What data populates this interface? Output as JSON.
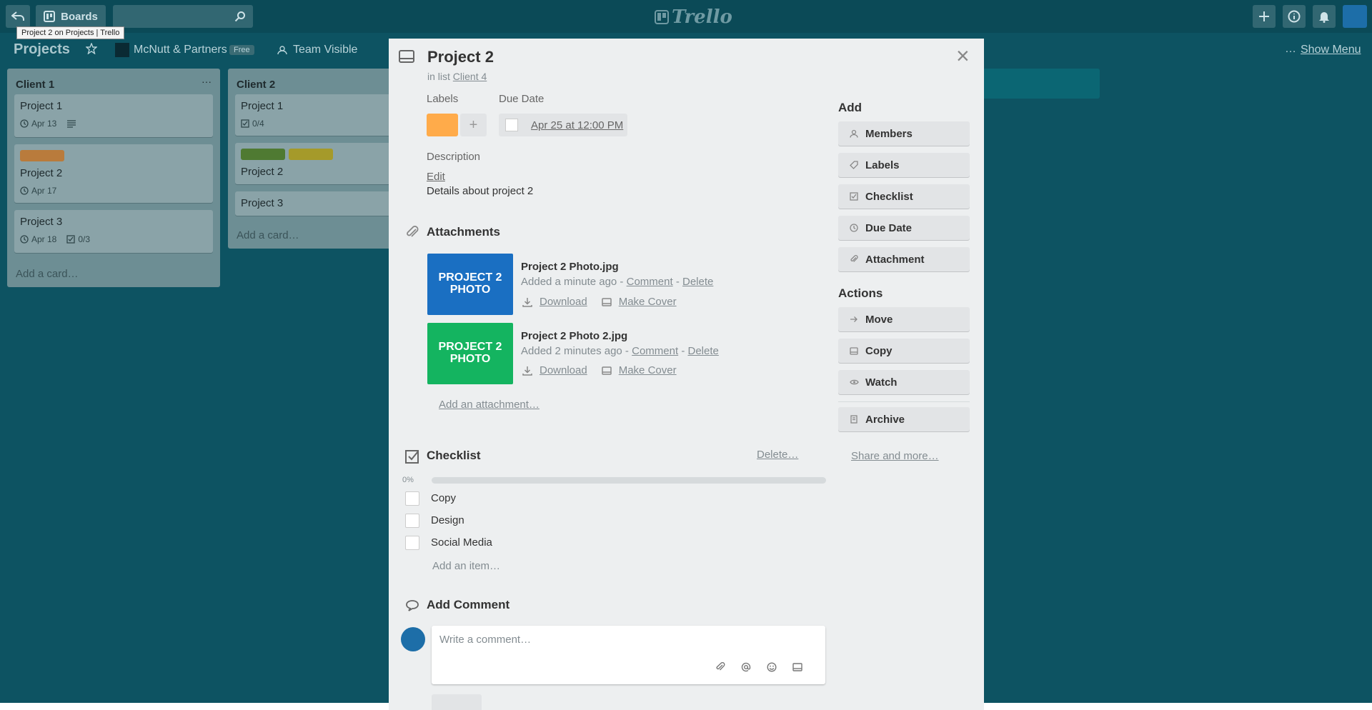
{
  "tooltip": "Project 2 on Projects | Trello",
  "header": {
    "boards_label": "Boards",
    "logo": "Trello"
  },
  "board": {
    "title": "Projects",
    "team": "McNutt & Partners",
    "plan_badge": "Free",
    "visibility": "Team Visible",
    "show_menu": "Show Menu",
    "more": "…"
  },
  "lists": [
    {
      "title": "Client 1",
      "menu": "···",
      "cards": [
        {
          "title": "Project 1",
          "due": "Apr 13"
        },
        {
          "title": "Project 2",
          "due": "Apr 17"
        },
        {
          "title": "Project 3",
          "due": "Apr 18",
          "checklist": "0/3"
        }
      ],
      "add": "Add a card…"
    },
    {
      "title": "Client 2",
      "cards": [
        {
          "title": "Project 1",
          "checklist": "0/4"
        },
        {
          "title": "Project 2"
        },
        {
          "title": "Project 3"
        }
      ],
      "add": "Add a card…"
    }
  ],
  "card_detail": {
    "title": "Project 2",
    "in_list_prefix": "in list",
    "list_name": "Client 4",
    "labels_heading": "Labels",
    "label_color": "#ffab4a",
    "add_label": "+",
    "due_heading": "Due Date",
    "due_value": "Apr 25 at 12:00 PM",
    "description_heading": "Description",
    "description_edit": "Edit",
    "description_text": "Details about project 2",
    "attachments_heading": "Attachments",
    "attachments": [
      {
        "thumb_line1": "PROJECT 2",
        "thumb_line2": "PHOTO",
        "thumb_color": "#1a6fc2",
        "name": "Project 2 Photo.jpg",
        "added": "Added a minute ago -",
        "comment": "Comment",
        "sep": "-",
        "delete": "Delete",
        "download": "Download",
        "make_cover": "Make Cover"
      },
      {
        "thumb_line1": "PROJECT 2",
        "thumb_line2": "PHOTO",
        "thumb_color": "#14b460",
        "name": "Project 2 Photo 2.jpg",
        "added": "Added 2 minutes ago -",
        "comment": "Comment",
        "sep": "-",
        "delete": "Delete",
        "download": "Download",
        "make_cover": "Make Cover"
      }
    ],
    "add_attachment": "Add an attachment…",
    "checklist_heading": "Checklist",
    "checklist_delete": "Delete…",
    "checklist_progress": "0%",
    "checklist_items": [
      "Copy",
      "Design",
      "Social Media"
    ],
    "add_item": "Add an item…",
    "comment_heading": "Add Comment",
    "comment_placeholder": "Write a comment…",
    "close": "×"
  },
  "sidebar": {
    "add_heading": "Add",
    "add_buttons": [
      "Members",
      "Labels",
      "Checklist",
      "Due Date",
      "Attachment"
    ],
    "actions_heading": "Actions",
    "action_buttons": [
      "Move",
      "Copy",
      "Watch"
    ],
    "archive": "Archive",
    "share": "Share and more…"
  }
}
